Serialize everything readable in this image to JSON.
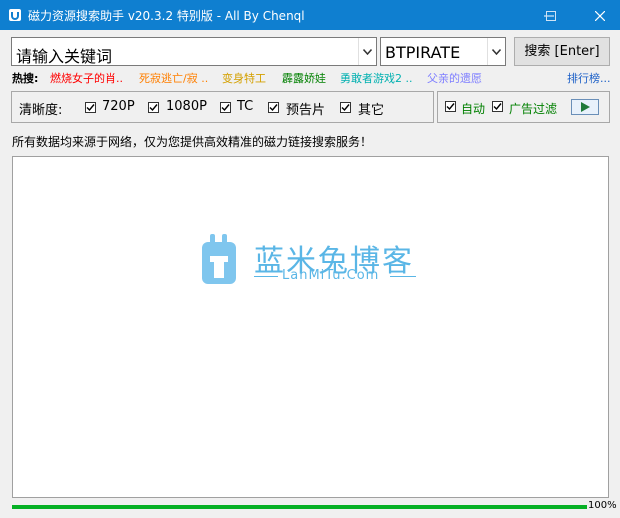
{
  "window": {
    "title": "磁力资源搜索助手 v20.3.2 特别版 - All By Chenql",
    "title_bar_color": "#0f7fd0"
  },
  "search": {
    "keyword_value": "请输入关键词",
    "engine_value": "BTPIRATE",
    "search_button_label": "搜索 [Enter]"
  },
  "hot": {
    "label": "热搜:",
    "items": [
      {
        "text": "燃烧女子的肖..",
        "color": "#ff0000"
      },
      {
        "text": "死寂逃亡/寂 ..",
        "color": "#ff7f00"
      },
      {
        "text": "变身特工",
        "color": "#d4a000"
      },
      {
        "text": "霹露娇娃",
        "color": "#008000"
      },
      {
        "text": "勇敢者游戏2 ..",
        "color": "#00b0b0"
      },
      {
        "text": "父亲的遗愿",
        "color": "#7f7fff"
      }
    ],
    "ranking_link": "排行榜..."
  },
  "filters": {
    "label": "清晰度:",
    "options": [
      {
        "label": "720P",
        "checked": true
      },
      {
        "label": "1080P",
        "checked": true
      },
      {
        "label": "TC",
        "checked": true
      },
      {
        "label": "预告片",
        "checked": true
      },
      {
        "label": "其它",
        "checked": true
      }
    ],
    "auto_label": "自动",
    "ad_filter_label": "广告过滤",
    "accent_green": "#008000"
  },
  "notice": "所有数据均来源于网络，仅为您提供高效精准的磁力链接搜索服务！",
  "watermark": {
    "title": "蓝米兔博客",
    "subtitle": "LanMiTu.Com"
  },
  "progress": {
    "value": 100,
    "text": "100%"
  }
}
